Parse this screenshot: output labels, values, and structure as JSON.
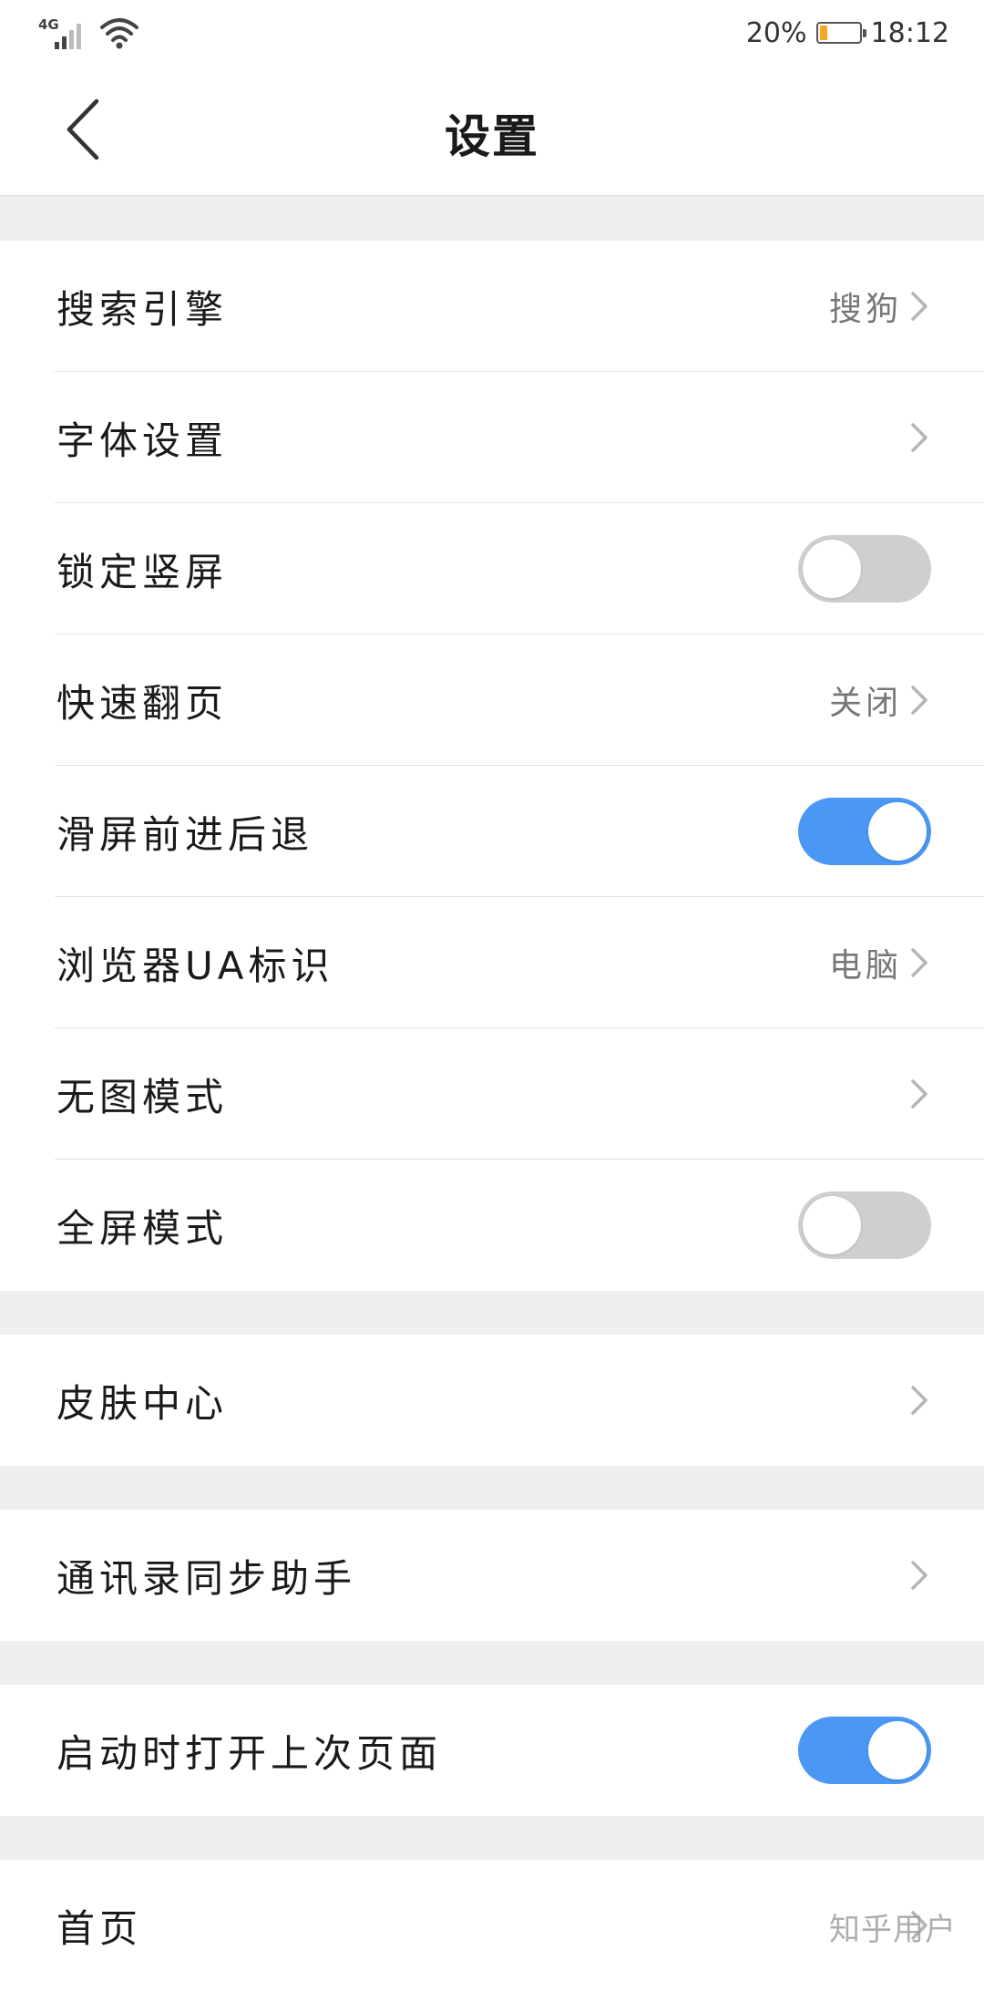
{
  "status_bar": {
    "network": "4G",
    "battery_percent": "20%",
    "battery_level": 0.2,
    "time": "18:12",
    "battery_color": "#f5a623"
  },
  "header": {
    "back_icon": "chevron-left-icon",
    "title": "设置"
  },
  "groups": [
    {
      "items": [
        {
          "label": "搜索引擎",
          "type": "link",
          "value": "搜狗"
        },
        {
          "label": "字体设置",
          "type": "link",
          "value": ""
        },
        {
          "label": "锁定竖屏",
          "type": "toggle",
          "on": false
        },
        {
          "label": "快速翻页",
          "type": "link",
          "value": "关闭"
        },
        {
          "label": "滑屏前进后退",
          "type": "toggle",
          "on": true
        },
        {
          "label": "浏览器UA标识",
          "type": "link",
          "value": "电脑"
        },
        {
          "label": "无图模式",
          "type": "link",
          "value": ""
        },
        {
          "label": "全屏模式",
          "type": "toggle",
          "on": false
        }
      ]
    },
    {
      "items": [
        {
          "label": "皮肤中心",
          "type": "link",
          "value": ""
        }
      ]
    },
    {
      "items": [
        {
          "label": "通讯录同步助手",
          "type": "link",
          "value": ""
        }
      ]
    },
    {
      "items": [
        {
          "label": "启动时打开上次页面",
          "type": "toggle",
          "on": true
        }
      ]
    },
    {
      "items": [
        {
          "label": "首页",
          "type": "link",
          "value": ""
        }
      ]
    }
  ],
  "watermark": "知乎用户",
  "colors": {
    "toggle_on": "#4a97f5",
    "toggle_off": "#cfcfcf",
    "background": "#efefef"
  }
}
